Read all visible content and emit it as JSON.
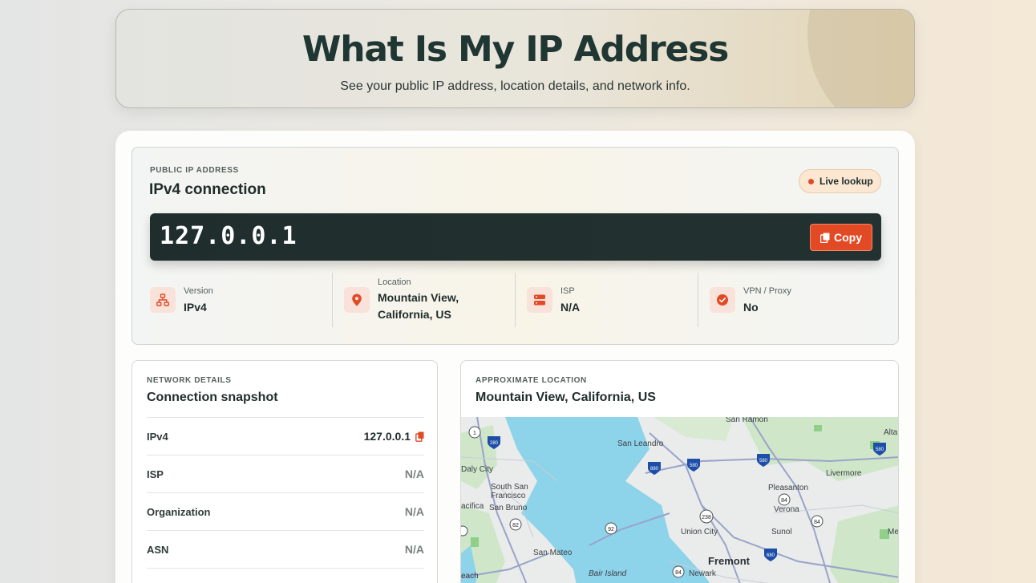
{
  "hero": {
    "title": "What Is My IP Address",
    "subtitle": "See your public IP address, location details, and network info."
  },
  "ip_panel": {
    "eyebrow": "PUBLIC IP ADDRESS",
    "title": "IPv4 connection",
    "badge": "Live lookup",
    "ip": "127.0.0.1",
    "copy_label": "Copy",
    "stats": [
      {
        "icon": "network-icon",
        "label": "Version",
        "value": "IPv4"
      },
      {
        "icon": "map-pin-icon",
        "label": "Location",
        "value_line1": "Mountain View,",
        "value_line2": "California, US"
      },
      {
        "icon": "server-icon",
        "label": "ISP",
        "value": "N/A"
      },
      {
        "icon": "shield-check-icon",
        "label": "VPN / Proxy",
        "value": "No"
      }
    ]
  },
  "network": {
    "eyebrow": "NETWORK DETAILS",
    "title": "Connection snapshot",
    "rows": [
      {
        "key": "IPv4",
        "value": "127.0.0.1"
      },
      {
        "key": "ISP",
        "value": "N/A"
      },
      {
        "key": "Organization",
        "value": "N/A"
      },
      {
        "key": "ASN",
        "value": "N/A"
      }
    ]
  },
  "map": {
    "eyebrow": "APPROXIMATE LOCATION",
    "title": "Mountain View, California, US",
    "labels": {
      "san_ramon": "San Ramon",
      "san_leandro": "San Leandro",
      "alta": "Alta",
      "daly_city": "Daly City",
      "south_sf_1": "South San",
      "south_sf_2": "Francisco",
      "pleasanton": "Pleasanton",
      "livermore": "Livermore",
      "pacifica": "acifica",
      "san_bruno": "San Bruno",
      "verona": "Verona",
      "union_city": "Union City",
      "sunol": "Sunol",
      "me": "Me",
      "san_mateo": "San Mateo",
      "fremont": "Fremont",
      "bair_island": "Bair Island",
      "newark": "Newark",
      "beach": "each"
    },
    "shields": {
      "r1": "1",
      "r280": "280",
      "r880": "880",
      "r580a": "580",
      "r580b": "580",
      "r580c": "580",
      "r238": "238",
      "r84a": "84",
      "r82": "82",
      "r92": "92",
      "r84b": "84",
      "r680": "680",
      "r84c": "84"
    }
  }
}
